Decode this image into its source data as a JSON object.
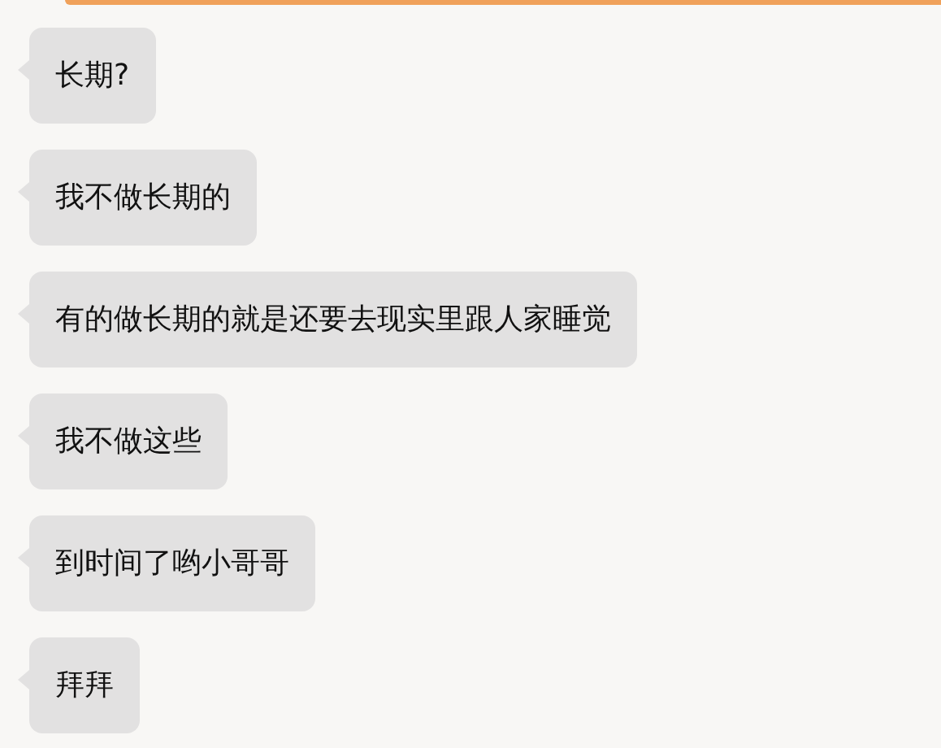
{
  "messages": [
    {
      "text": "长期?"
    },
    {
      "text": "我不做长期的"
    },
    {
      "text": "有的做长期的就是还要去现实里跟人家睡觉"
    },
    {
      "text": "我不做这些"
    },
    {
      "text": "到时间了哟小哥哥"
    },
    {
      "text": "拜拜"
    }
  ]
}
